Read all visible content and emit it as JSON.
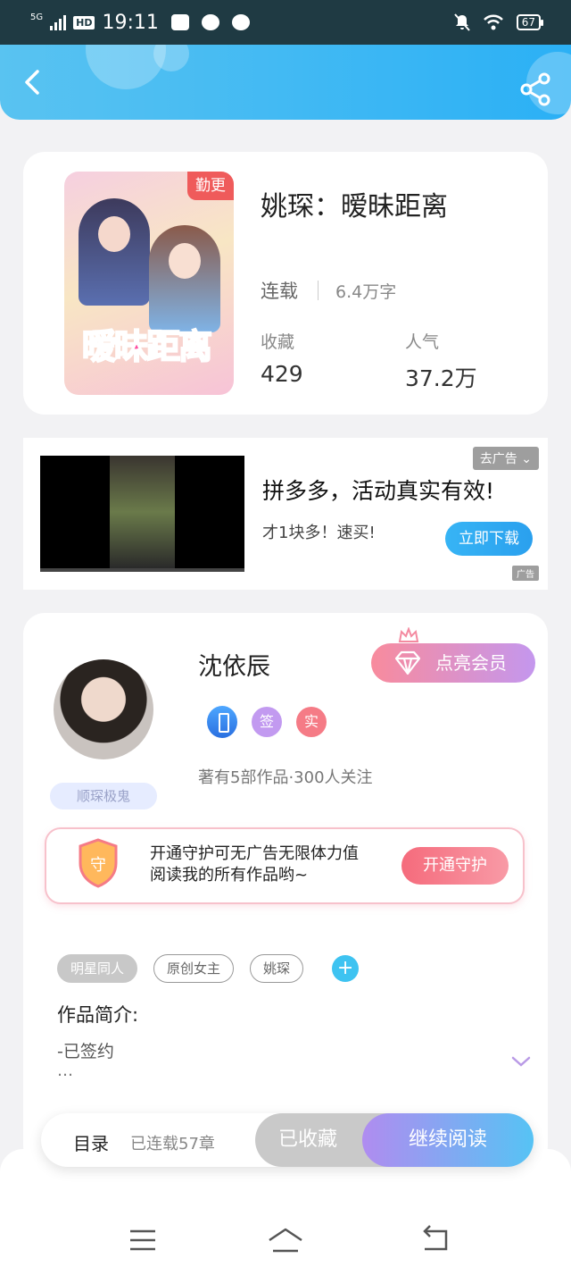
{
  "status_bar": {
    "net": "5G",
    "hd": "HD",
    "time": "19:11",
    "battery": "67"
  },
  "book": {
    "title": "姚琛：暧昧距离",
    "badge": "勤更",
    "cover_text": "暧昧距离",
    "status": "连载",
    "words": "6.4万字",
    "favorites_label": "收藏",
    "favorites_value": "429",
    "popularity_label": "人气",
    "popularity_value": "37.2万"
  },
  "ad": {
    "close_label": "去广告",
    "title": "拼多多，活动真实有效!",
    "subtitle": "才1块多！速买!",
    "download_label": "立即下载",
    "mark": "广告"
  },
  "author": {
    "name": "沈依辰",
    "fan_badge": "顺琛极鬼",
    "vip_label": "点亮会员",
    "badge_sign": "签",
    "badge_real": "实",
    "info": "著有5部作品·300人关注",
    "guard_shield": "守",
    "guard_text_line1": "开通守护可无广告无限体力值",
    "guard_text_line2": "阅读我的所有作品哟~",
    "guard_button": "开通守护"
  },
  "tags": [
    "明星同人",
    "原创女主",
    "姚琛"
  ],
  "tag_add": "+",
  "intro": {
    "title": "作品简介:",
    "text": "-已签约",
    "more": "…"
  },
  "action_bar": {
    "toc_label": "目录",
    "chapter_count": "已连载57章",
    "favorited_label": "已收藏",
    "continue_label": "继续阅读"
  },
  "colors": {
    "header": "#2bb0f5",
    "accent_blue": "#3ec3f1",
    "pink": "#f56b7c",
    "purple": "#b08cf0"
  }
}
